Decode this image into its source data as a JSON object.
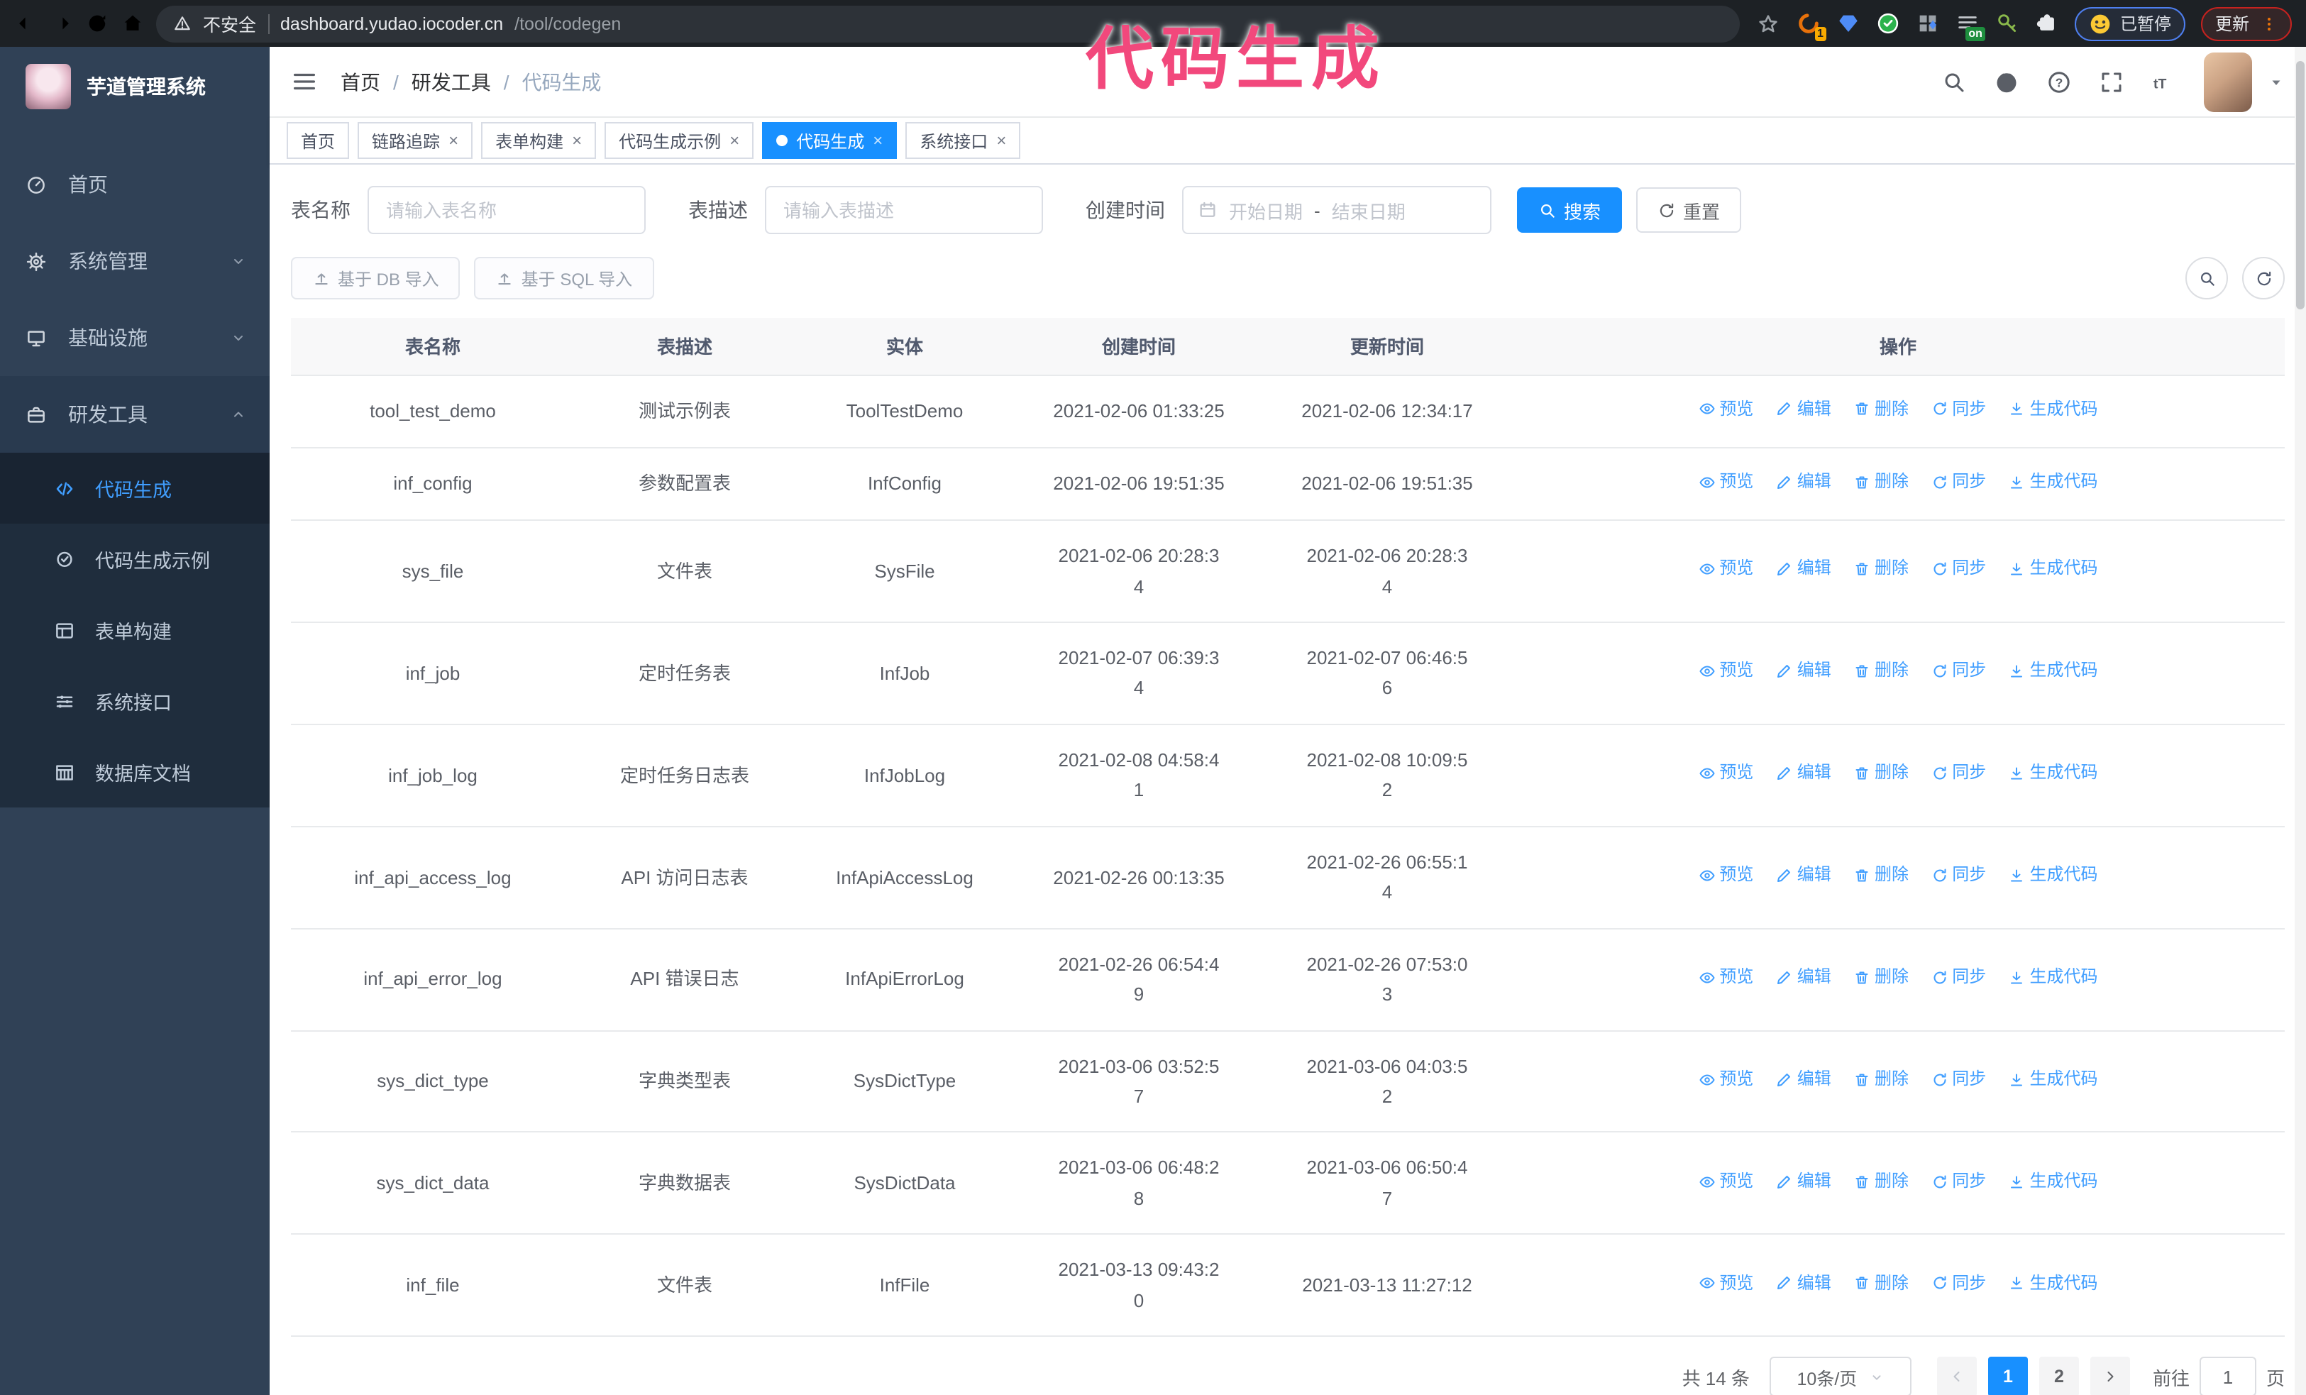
{
  "browser": {
    "security_text": "不安全",
    "url_host": "dashboard.yudao.iocoder.cn",
    "url_path": "/tool/codegen",
    "ext_badge_1": "1",
    "ext_on_badge": "on",
    "paused_label": "已暂停",
    "update_label": "更新"
  },
  "annotation": {
    "text": "代码生成",
    "color": "#f2487c"
  },
  "sidebar": {
    "title": "芋道管理系统",
    "items": [
      {
        "icon": "dashboard-icon",
        "label": "首页"
      },
      {
        "icon": "gear-icon",
        "label": "系统管理",
        "chevron": "down"
      },
      {
        "icon": "monitor-icon",
        "label": "基础设施",
        "chevron": "down"
      },
      {
        "icon": "toolbox-icon",
        "label": "研发工具",
        "chevron": "up",
        "expanded": true
      }
    ],
    "sub_items": [
      {
        "icon": "code-icon",
        "label": "代码生成",
        "active": true
      },
      {
        "icon": "badge-check-icon",
        "label": "代码生成示例"
      },
      {
        "icon": "form-icon",
        "label": "表单构建"
      },
      {
        "icon": "sliders-icon",
        "label": "系统接口"
      },
      {
        "icon": "database-icon",
        "label": "数据库文档"
      }
    ]
  },
  "breadcrumb": {
    "0": "首页",
    "1": "研发工具",
    "2": "代码生成"
  },
  "tabs": [
    {
      "label": "首页",
      "closable": false,
      "active": false
    },
    {
      "label": "链路追踪",
      "closable": true,
      "active": false
    },
    {
      "label": "表单构建",
      "closable": true,
      "active": false
    },
    {
      "label": "代码生成示例",
      "closable": true,
      "active": false
    },
    {
      "label": "代码生成",
      "closable": true,
      "active": true
    },
    {
      "label": "系统接口",
      "closable": true,
      "active": false
    }
  ],
  "filter": {
    "name_label": "表名称",
    "name_placeholder": "请输入表名称",
    "desc_label": "表描述",
    "desc_placeholder": "请输入表描述",
    "time_label": "创建时间",
    "start_placeholder": "开始日期",
    "range_separator": "-",
    "end_placeholder": "结束日期",
    "search_label": "搜索",
    "reset_label": "重置"
  },
  "toolbar": {
    "import_db_label": "基于 DB 导入",
    "import_sql_label": "基于 SQL 导入"
  },
  "table": {
    "columns": [
      "表名称",
      "表描述",
      "实体",
      "创建时间",
      "更新时间",
      "操作"
    ],
    "actions": [
      {
        "icon": "eye-icon",
        "label": "预览"
      },
      {
        "icon": "edit-icon",
        "label": "编辑"
      },
      {
        "icon": "trash-icon",
        "label": "删除"
      },
      {
        "icon": "sync-icon",
        "label": "同步"
      },
      {
        "icon": "download-icon",
        "label": "生成代码"
      }
    ],
    "rows": [
      {
        "name": "tool_test_demo",
        "desc": "测试示例表",
        "entity": "ToolTestDemo",
        "created": "2021-02-06 01:33:25",
        "updated": "2021-02-06 12:34:17"
      },
      {
        "name": "inf_config",
        "desc": "参数配置表",
        "entity": "InfConfig",
        "created": "2021-02-06 19:51:35",
        "updated": "2021-02-06 19:51:35"
      },
      {
        "name": "sys_file",
        "desc": "文件表",
        "entity": "SysFile",
        "created": "2021-02-06 20:28:3\n4",
        "updated": "2021-02-06 20:28:3\n4"
      },
      {
        "name": "inf_job",
        "desc": "定时任务表",
        "entity": "InfJob",
        "created": "2021-02-07 06:39:3\n4",
        "updated": "2021-02-07 06:46:5\n6"
      },
      {
        "name": "inf_job_log",
        "desc": "定时任务日志表",
        "entity": "InfJobLog",
        "created": "2021-02-08 04:58:4\n1",
        "updated": "2021-02-08 10:09:5\n2"
      },
      {
        "name": "inf_api_access_log",
        "desc": "API 访问日志表",
        "entity": "InfApiAccessLog",
        "created": "2021-02-26 00:13:35",
        "updated": "2021-02-26 06:55:1\n4"
      },
      {
        "name": "inf_api_error_log",
        "desc": "API 错误日志",
        "entity": "InfApiErrorLog",
        "created": "2021-02-26 06:54:4\n9",
        "updated": "2021-02-26 07:53:0\n3"
      },
      {
        "name": "sys_dict_type",
        "desc": "字典类型表",
        "entity": "SysDictType",
        "created": "2021-03-06 03:52:5\n7",
        "updated": "2021-03-06 04:03:5\n2"
      },
      {
        "name": "sys_dict_data",
        "desc": "字典数据表",
        "entity": "SysDictData",
        "created": "2021-03-06 06:48:2\n8",
        "updated": "2021-03-06 06:50:4\n7"
      },
      {
        "name": "inf_file",
        "desc": "文件表",
        "entity": "InfFile",
        "created": "2021-03-13 09:43:2\n0",
        "updated": "2021-03-13 11:27:12"
      }
    ]
  },
  "pagination": {
    "total": "共 14 条",
    "per_page": "10条/页",
    "pages": [
      "1",
      "2"
    ],
    "active_page": "1",
    "goto_label": "前往",
    "goto_value": "1",
    "page_unit": "页"
  },
  "colors": {
    "primary": "#1890ff",
    "link": "#409eff",
    "sidebar_bg": "#304156",
    "submenu_bg": "#1f2d3d",
    "annotation": "#f2487c"
  }
}
